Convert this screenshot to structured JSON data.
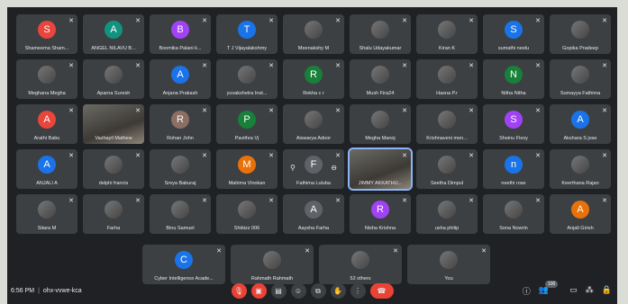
{
  "tiles": [
    {
      "name": "Shameema Sham...",
      "initial": "S",
      "color": "#e8453c"
    },
    {
      "name": "ANGEL NILAVU B...",
      "initial": "A",
      "color": "#12937f"
    },
    {
      "name": "Boomika Palani k...",
      "initial": "B",
      "color": "#a142f4"
    },
    {
      "name": "T J Vijayalakshmy",
      "initial": "T",
      "color": "#1a73e8"
    },
    {
      "name": "Meenakshy M",
      "initial": "",
      "color": ""
    },
    {
      "name": "Shalu Udayakumar",
      "initial": "",
      "color": ""
    },
    {
      "name": "Kiran K",
      "initial": "",
      "color": ""
    },
    {
      "name": "sumathi neelu",
      "initial": "S",
      "color": "#1a73e8"
    },
    {
      "name": "Gopika Pradeep",
      "initial": "",
      "color": ""
    },
    {
      "name": "Meghana Megha",
      "initial": "",
      "color": ""
    },
    {
      "name": "Aparna Suresh",
      "initial": "",
      "color": ""
    },
    {
      "name": "Anjana Prakash",
      "initial": "A",
      "color": "#1a73e8"
    },
    {
      "name": "yuvakshetra Inst...",
      "initial": "",
      "color": ""
    },
    {
      "name": "Rekha c r",
      "initial": "R",
      "color": "#188038"
    },
    {
      "name": "Mush Fira24",
      "initial": "",
      "color": ""
    },
    {
      "name": "Hasna P.r",
      "initial": "",
      "color": ""
    },
    {
      "name": "Nitha Nitha",
      "initial": "N",
      "color": "#188038"
    },
    {
      "name": "Sumayya Fathima",
      "initial": "",
      "color": ""
    },
    {
      "name": "Arathi Babu",
      "initial": "A",
      "color": "#e8453c"
    },
    {
      "name": "Vazhayil Mathew",
      "initial": "",
      "color": "",
      "video": true
    },
    {
      "name": "Rohan John",
      "initial": "R",
      "color": "#8d6e63"
    },
    {
      "name": "Pavithra Vj",
      "initial": "P",
      "color": "#188038"
    },
    {
      "name": "Aiswarya Adoor",
      "initial": "",
      "color": ""
    },
    {
      "name": "Megha Manoj",
      "initial": "",
      "color": ""
    },
    {
      "name": "Krishnaveni men...",
      "initial": "",
      "color": ""
    },
    {
      "name": "Sheinu Flexy",
      "initial": "S",
      "color": "#a142f4"
    },
    {
      "name": "Akshara S jose",
      "initial": "A",
      "color": "#1a73e8"
    },
    {
      "name": "ANJALI A",
      "initial": "A",
      "color": "#1a73e8"
    },
    {
      "name": "delphi francis",
      "initial": "",
      "color": ""
    },
    {
      "name": "Sreya Baburaj",
      "initial": "",
      "color": ""
    },
    {
      "name": "Mahima Vinokan",
      "initial": "M",
      "color": "#e8710a"
    },
    {
      "name": "Fathima Luluba",
      "initial": "F",
      "color": "#5f6368",
      "hover": true
    },
    {
      "name": "JIMMY AKKATHU...",
      "initial": "",
      "color": "",
      "video": true,
      "speaking": true
    },
    {
      "name": "Seetha Dimpul",
      "initial": "",
      "color": ""
    },
    {
      "name": "neethi rose",
      "initial": "n",
      "color": "#1a73e8"
    },
    {
      "name": "Keerthana Rajan",
      "initial": "",
      "color": ""
    },
    {
      "name": "Sitara M",
      "initial": "",
      "color": ""
    },
    {
      "name": "Farha",
      "initial": "",
      "color": ""
    },
    {
      "name": "Binu Samuel",
      "initial": "",
      "color": ""
    },
    {
      "name": "Shibizz 006",
      "initial": "",
      "color": ""
    },
    {
      "name": "Aaysha Farha",
      "initial": "A",
      "color": "#5f6368"
    },
    {
      "name": "Nisha Krishna",
      "initial": "R",
      "color": "#a142f4"
    },
    {
      "name": "usha philip",
      "initial": "",
      "color": ""
    },
    {
      "name": "Sona Nowrin",
      "initial": "",
      "color": ""
    },
    {
      "name": "Anjali Girish",
      "initial": "A",
      "color": "#e8710a"
    }
  ],
  "last_row": [
    {
      "name": "Cyber Intelligence Acade...",
      "initial": "C",
      "color": "#1a73e8"
    },
    {
      "name": "Rahmath Rahmath",
      "initial": "",
      "color": ""
    },
    {
      "name": "52 others",
      "initial": "",
      "color": ""
    },
    {
      "name": "You",
      "initial": "",
      "color": ""
    }
  ],
  "meeting": {
    "time": "6:56 PM",
    "code": "ohx-vvwe-kca"
  },
  "participants_count": "100"
}
